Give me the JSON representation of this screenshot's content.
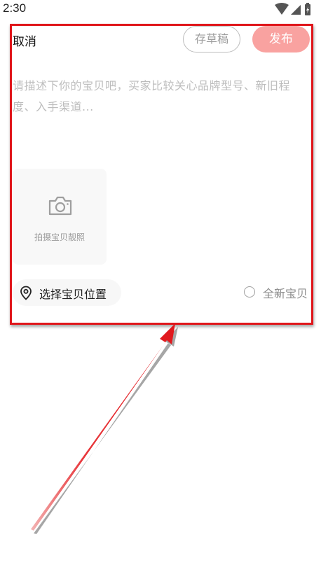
{
  "status_bar": {
    "time": "2:30"
  },
  "header": {
    "cancel_label": "取消",
    "draft_label": "存草稿",
    "publish_label": "发布"
  },
  "description": {
    "placeholder": "请描述下你的宝贝吧，买家比较关心品牌型号、新旧程度、入手渠道..."
  },
  "photo": {
    "label": "拍摄宝贝靓照",
    "icon": "camera-icon"
  },
  "footer": {
    "location_label": "选择宝贝位置",
    "location_icon": "location-pin-icon",
    "new_item_label": "全新宝贝",
    "new_item_checked": false
  },
  "colors": {
    "highlight": "#e0161b",
    "publish_bg": "#f9a2a0",
    "placeholder_text": "#bdbdbd"
  }
}
